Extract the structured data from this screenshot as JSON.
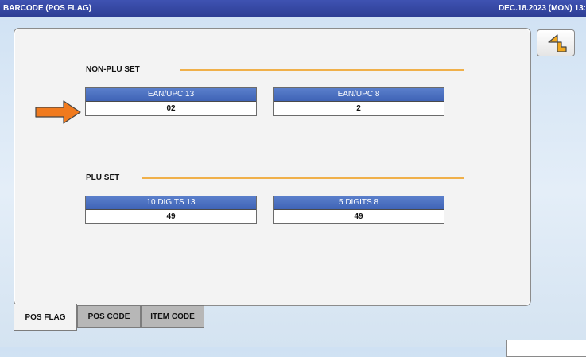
{
  "titlebar": {
    "title": "BARCODE (POS FLAG)",
    "datetime": "DEC.18.2023 (MON)  13:"
  },
  "non_plu": {
    "label": "NON-PLU SET",
    "fields": [
      {
        "header": "EAN/UPC 13",
        "value": "02"
      },
      {
        "header": "EAN/UPC 8",
        "value": "2"
      }
    ]
  },
  "plu": {
    "label": "PLU SET",
    "fields": [
      {
        "header": "10 DIGITS 13",
        "value": "49"
      },
      {
        "header": "5 DIGITS 8",
        "value": "49"
      }
    ]
  },
  "tabs": [
    {
      "label": "POS FLAG",
      "active": true
    },
    {
      "label": "POS CODE",
      "active": false
    },
    {
      "label": "ITEM CODE",
      "active": false
    }
  ],
  "colors": {
    "title_bar": "#2c3d93",
    "field_header": "#4a6fc0",
    "section_line": "#f0b04a",
    "arrow": "#f07a1e"
  },
  "icons": {
    "back": "return-arrow-icon",
    "pointer": "orange-arrow-icon"
  }
}
